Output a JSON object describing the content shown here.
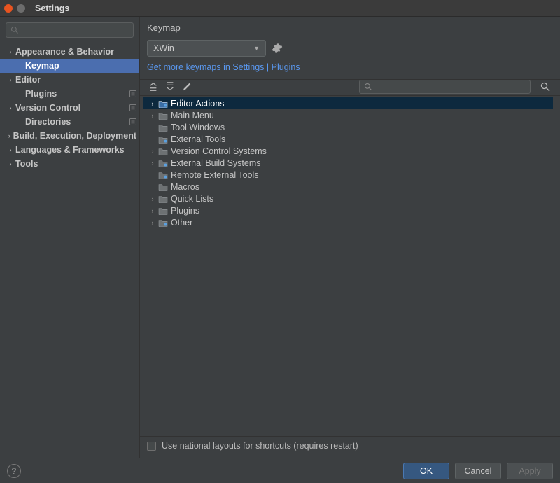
{
  "window": {
    "title": "Settings"
  },
  "sidebar": {
    "search_placeholder": "",
    "items": [
      {
        "label": "Appearance & Behavior",
        "expandable": true,
        "bold": true,
        "indent": false
      },
      {
        "label": "Keymap",
        "expandable": false,
        "bold": true,
        "indent": true,
        "selected": true
      },
      {
        "label": "Editor",
        "expandable": true,
        "bold": true,
        "indent": false
      },
      {
        "label": "Plugins",
        "expandable": false,
        "bold": true,
        "indent": true,
        "badge": "project"
      },
      {
        "label": "Version Control",
        "expandable": true,
        "bold": true,
        "indent": false,
        "badge": "project"
      },
      {
        "label": "Directories",
        "expandable": false,
        "bold": true,
        "indent": true,
        "badge": "project"
      },
      {
        "label": "Build, Execution, Deployment",
        "expandable": true,
        "bold": true,
        "indent": false
      },
      {
        "label": "Languages & Frameworks",
        "expandable": true,
        "bold": true,
        "indent": false
      },
      {
        "label": "Tools",
        "expandable": true,
        "bold": true,
        "indent": false
      }
    ]
  },
  "main": {
    "breadcrumb": "Keymap",
    "scheme_selected": "XWin",
    "link_prefix": "Get more keymaps in ",
    "link_settings": "Settings",
    "link_sep": " | ",
    "link_plugins": "Plugins",
    "tree_search_placeholder": "",
    "tree": [
      {
        "label": "Editor Actions",
        "expandable": true,
        "selected": true,
        "icon": "folder-special"
      },
      {
        "label": "Main Menu",
        "expandable": true,
        "icon": "folder"
      },
      {
        "label": "Tool Windows",
        "expandable": false,
        "icon": "folder"
      },
      {
        "label": "External Tools",
        "expandable": false,
        "icon": "folder-special"
      },
      {
        "label": "Version Control Systems",
        "expandable": true,
        "icon": "folder"
      },
      {
        "label": "External Build Systems",
        "expandable": true,
        "icon": "folder-special"
      },
      {
        "label": "Remote External Tools",
        "expandable": false,
        "icon": "folder-special"
      },
      {
        "label": "Macros",
        "expandable": false,
        "icon": "folder"
      },
      {
        "label": "Quick Lists",
        "expandable": true,
        "icon": "folder"
      },
      {
        "label": "Plugins",
        "expandable": true,
        "icon": "folder"
      },
      {
        "label": "Other",
        "expandable": true,
        "icon": "folder-special"
      }
    ],
    "national_label": "Use national layouts for shortcuts (requires restart)",
    "national_checked": false
  },
  "footer": {
    "ok": "OK",
    "cancel": "Cancel",
    "apply": "Apply"
  }
}
